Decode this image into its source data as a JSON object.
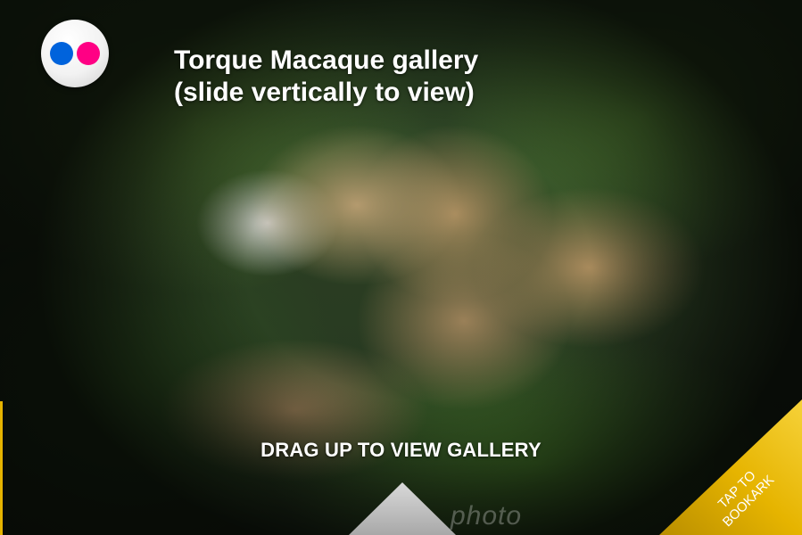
{
  "app": {
    "logo_icon": "flickr-logo-icon",
    "logo_colors": {
      "left_dot": "#0063dc",
      "right_dot": "#ff0084"
    }
  },
  "header": {
    "title_line1": "Torque Macaque gallery",
    "title_line2": "(slide vertically to view)"
  },
  "footer": {
    "drag_label": "DRAG UP TO VIEW GALLERY",
    "drag_icon": "up-triangle-icon",
    "watermark": "photo"
  },
  "bookmark": {
    "line1": "TAP TO",
    "line2": "BOOKARK",
    "color": "#e6b400"
  }
}
